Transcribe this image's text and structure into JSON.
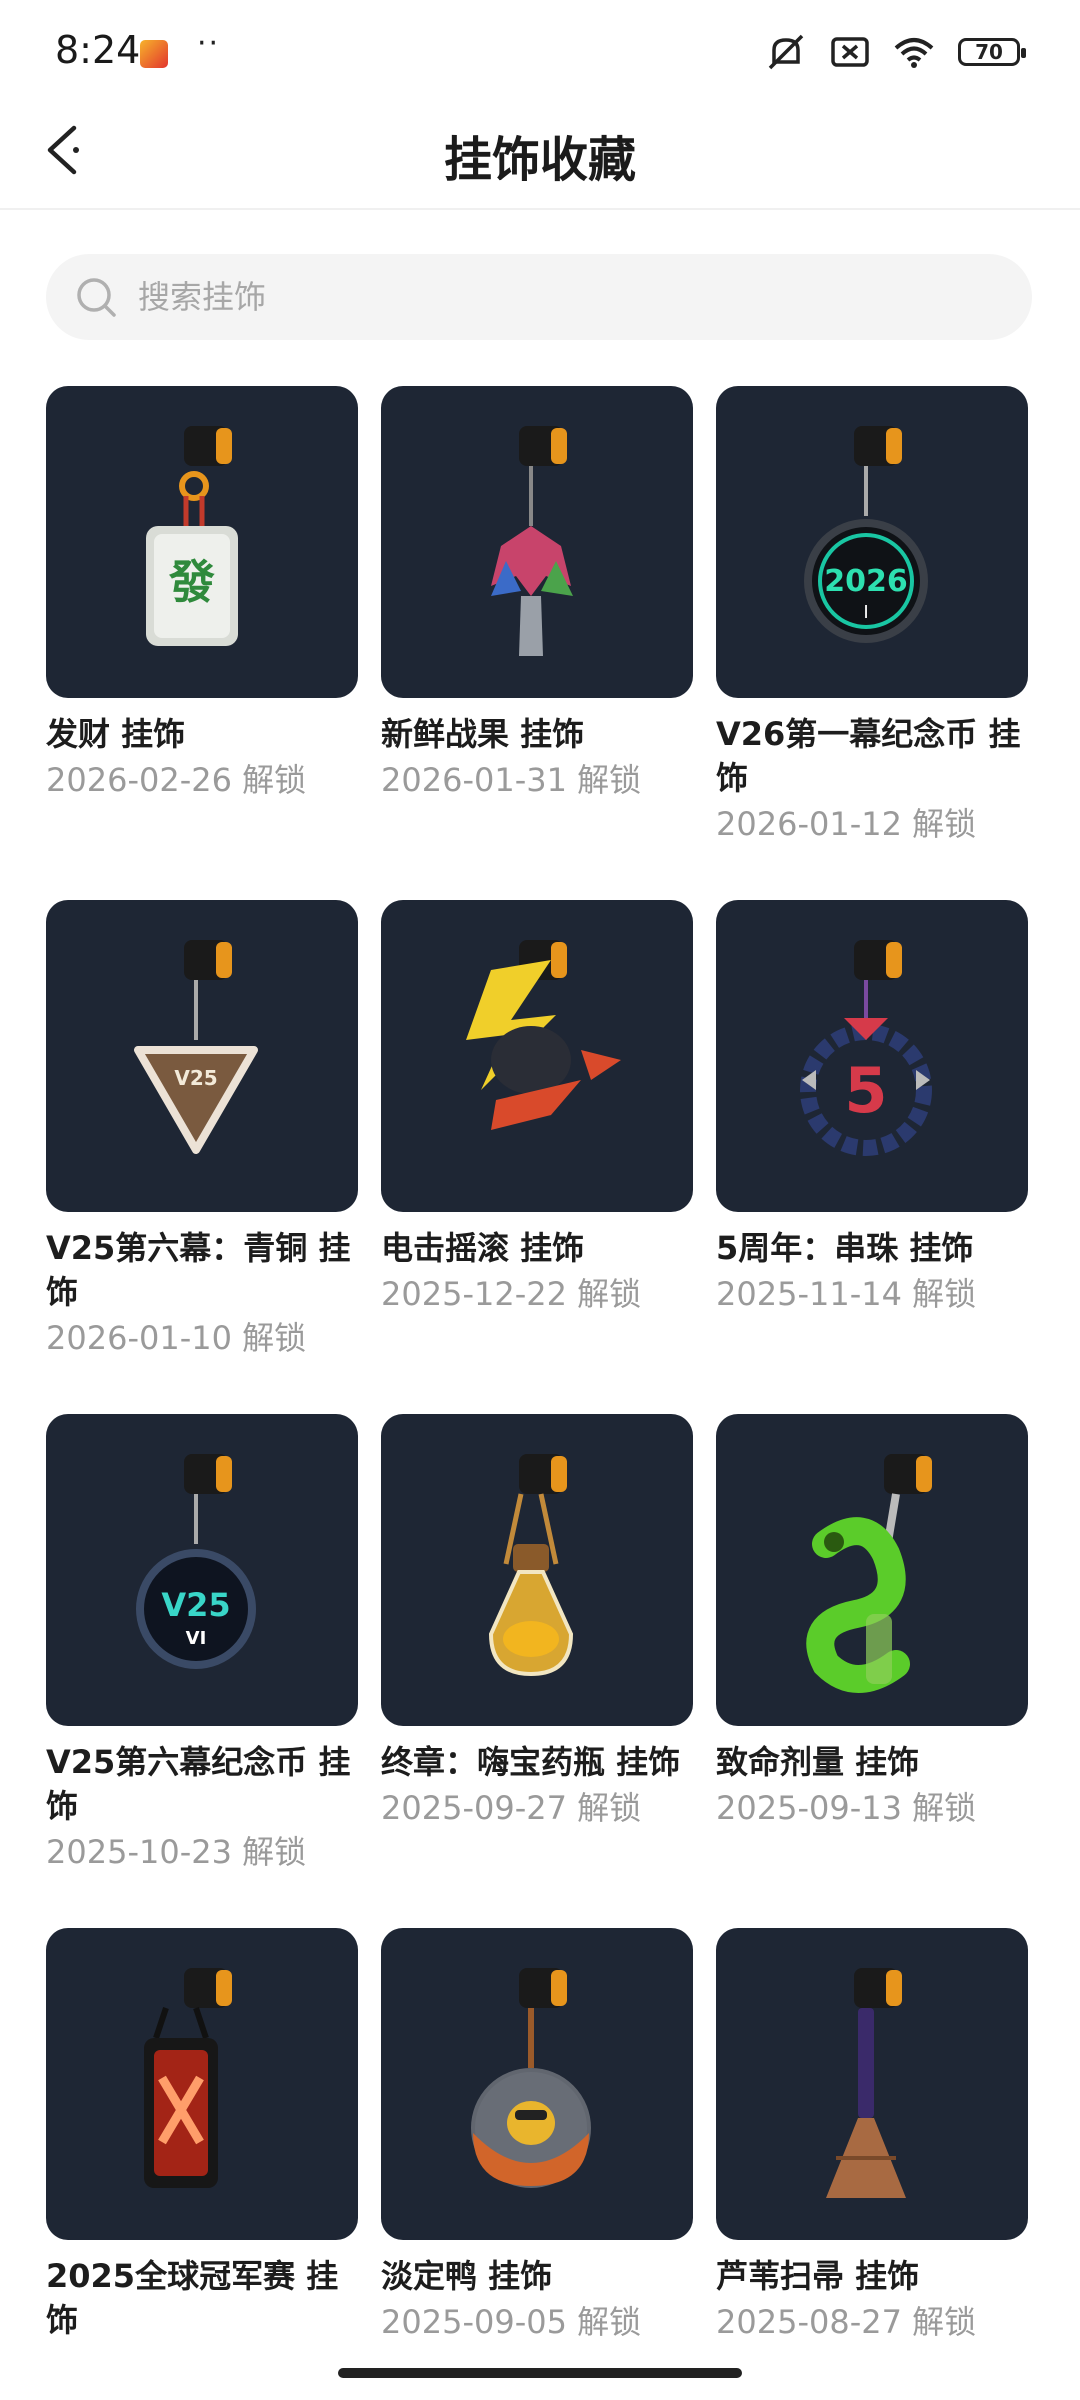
{
  "status": {
    "time": "8:24",
    "dots": "··",
    "battery": "70"
  },
  "header": {
    "title": "挂饰收藏"
  },
  "search": {
    "placeholder": "搜索挂饰",
    "value": ""
  },
  "items": [
    {
      "name": "发财 挂饰",
      "date": "2026-02-26 解锁",
      "art": "mahjong-charm-icon"
    },
    {
      "name": "新鲜战果 挂饰",
      "date": "2026-01-31 解锁",
      "art": "fruit-tree-charm-icon"
    },
    {
      "name": "V26第一幕纪念币 挂饰",
      "date": "2026-01-12 解锁",
      "art": "coin-2026-charm-icon"
    },
    {
      "name": "V25第六幕：青铜 挂饰",
      "date": "2026-01-10 解锁",
      "art": "bronze-triangle-charm-icon"
    },
    {
      "name": "电击摇滚 挂饰",
      "date": "2025-12-22 解锁",
      "art": "lightning-charm-icon"
    },
    {
      "name": "5周年：串珠 挂饰",
      "date": "2025-11-14 解锁",
      "art": "bead-ring-charm-icon"
    },
    {
      "name": "V25第六幕纪念币 挂饰",
      "date": "2025-10-23 解锁",
      "art": "coin-v25-charm-icon"
    },
    {
      "name": "终章：嗨宝药瓶 挂饰",
      "date": "2025-09-27 解锁",
      "art": "potion-bottle-charm-icon"
    },
    {
      "name": "致命剂量 挂饰",
      "date": "2025-09-13 解锁",
      "art": "snake-charm-icon"
    },
    {
      "name": "2025全球冠军赛 挂饰",
      "date": "",
      "art": "champions-tag-charm-icon"
    },
    {
      "name": "淡定鸭 挂饰",
      "date": "2025-09-05 解锁",
      "art": "duck-ball-charm-icon"
    },
    {
      "name": "芦苇扫帚 挂饰",
      "date": "2025-08-27 解锁",
      "art": "broom-charm-icon"
    }
  ]
}
